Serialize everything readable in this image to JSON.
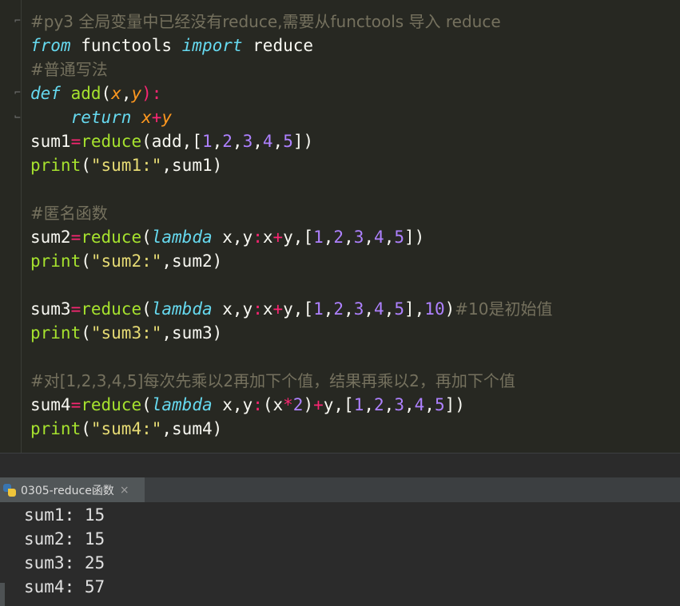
{
  "editor": {
    "comment_header": "#py3 全局变量中已经没有reduce,需要从functools 导入 reduce",
    "import_line": {
      "from": "from",
      "module": " functools ",
      "import": "import",
      "name": " reduce"
    },
    "comment_normal": "#普通写法",
    "def_line": {
      "def": "def",
      "name": "add",
      "open": "(",
      "p1": "x",
      "comma": ",",
      "p2": "y",
      "close": "):"
    },
    "return_line": {
      "indent": "    ",
      "return": "return",
      "p1": "x",
      "plus": "+",
      "p2": "y"
    },
    "sum1_line": {
      "var": "sum1",
      "eq": "=",
      "call": "reduce",
      "args_open": "(add,[",
      "n1": "1",
      "n2": "2",
      "n3": "3",
      "n4": "4",
      "n5": "5",
      "args_close": "])"
    },
    "print1": {
      "fn": "print",
      "open": "(",
      "str": "\"sum1:\"",
      "rest": ",sum1)"
    },
    "comment_anon": "#匿名函数",
    "sum2_line": {
      "var": "sum2",
      "eq": "=",
      "call": "reduce",
      "open": "(",
      "lambda": "lambda",
      "params": " x,y",
      "colon": ":",
      "body1": "x",
      "plus": "+",
      "body2": "y,[",
      "n1": "1",
      "n2": "2",
      "n3": "3",
      "n4": "4",
      "n5": "5",
      "close": "])"
    },
    "print2": {
      "fn": "print",
      "open": "(",
      "str": "\"sum2:\"",
      "rest": ",sum2)"
    },
    "sum3_line": {
      "var": "sum3",
      "eq": "=",
      "call": "reduce",
      "open": "(",
      "lambda": "lambda",
      "params": " x,y",
      "colon": ":",
      "body1": "x",
      "plus": "+",
      "body2": "y,[",
      "n1": "1",
      "n2": "2",
      "n3": "3",
      "n4": "4",
      "n5": "5",
      "mid": "],",
      "init": "10",
      "close": ")",
      "comment": "#10是初始值"
    },
    "print3": {
      "fn": "print",
      "open": "(",
      "str": "\"sum3:\"",
      "rest": ",sum3)"
    },
    "comment_sum4": "#对[1,2,3,4,5]每次先乘以2再加下个值，结果再乘以2，再加下个值",
    "sum4_line": {
      "var": "sum4",
      "eq": "=",
      "call": "reduce",
      "open": "(",
      "lambda": "lambda",
      "params": " x,y",
      "colon": ":",
      "body1": "(x",
      "mul": "*",
      "two": "2",
      "body2": ")",
      "plus": "+",
      "body3": "y,[",
      "n1": "1",
      "n2": "2",
      "n3": "3",
      "n4": "4",
      "n5": "5",
      "close": "])"
    },
    "print4": {
      "fn": "print",
      "open": "(",
      "str": "\"sum4:\"",
      "rest": ",sum4)"
    }
  },
  "run_tab": {
    "label": "0305-reduce函数",
    "close": "×"
  },
  "console": {
    "lines": [
      "sum1: 15",
      "sum2: 15",
      "sum3: 25",
      "sum4: 57"
    ]
  }
}
